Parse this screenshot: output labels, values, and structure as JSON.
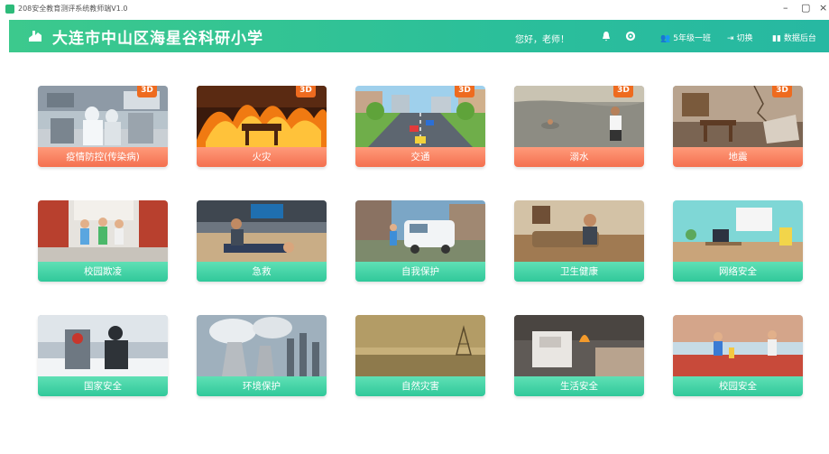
{
  "window": {
    "title": "208安全教育测评系统教师端V1.0",
    "controls": {
      "minimize": "–",
      "maximize": "▢",
      "close": "×"
    }
  },
  "header": {
    "school_name": "大连市中山区海星谷科研小学",
    "greeting": "您好，老师！",
    "class_label": "5年级一班",
    "switch_label": "切换",
    "data_label": "数据后台"
  },
  "colors": {
    "header": "#33c494",
    "badge": "#ee6b1f",
    "red_label": "#f4704f",
    "green_label": "#30c89a"
  },
  "cards": [
    {
      "label": "疫情防控(传染病)",
      "badge": "3D",
      "style": "red"
    },
    {
      "label": "火灾",
      "badge": "3D",
      "style": "red"
    },
    {
      "label": "交通",
      "badge": "3D",
      "style": "red"
    },
    {
      "label": "溺水",
      "badge": "3D",
      "style": "red"
    },
    {
      "label": "地震",
      "badge": "3D",
      "style": "red"
    },
    {
      "label": "校园欺凌",
      "style": "green"
    },
    {
      "label": "急救",
      "style": "green"
    },
    {
      "label": "自我保护",
      "style": "green"
    },
    {
      "label": "卫生健康",
      "style": "green"
    },
    {
      "label": "网络安全",
      "style": "green"
    },
    {
      "label": "国家安全",
      "style": "green"
    },
    {
      "label": "环境保护",
      "style": "green"
    },
    {
      "label": "自然灾害",
      "style": "green"
    },
    {
      "label": "生活安全",
      "style": "green"
    },
    {
      "label": "校园安全",
      "style": "green"
    }
  ]
}
